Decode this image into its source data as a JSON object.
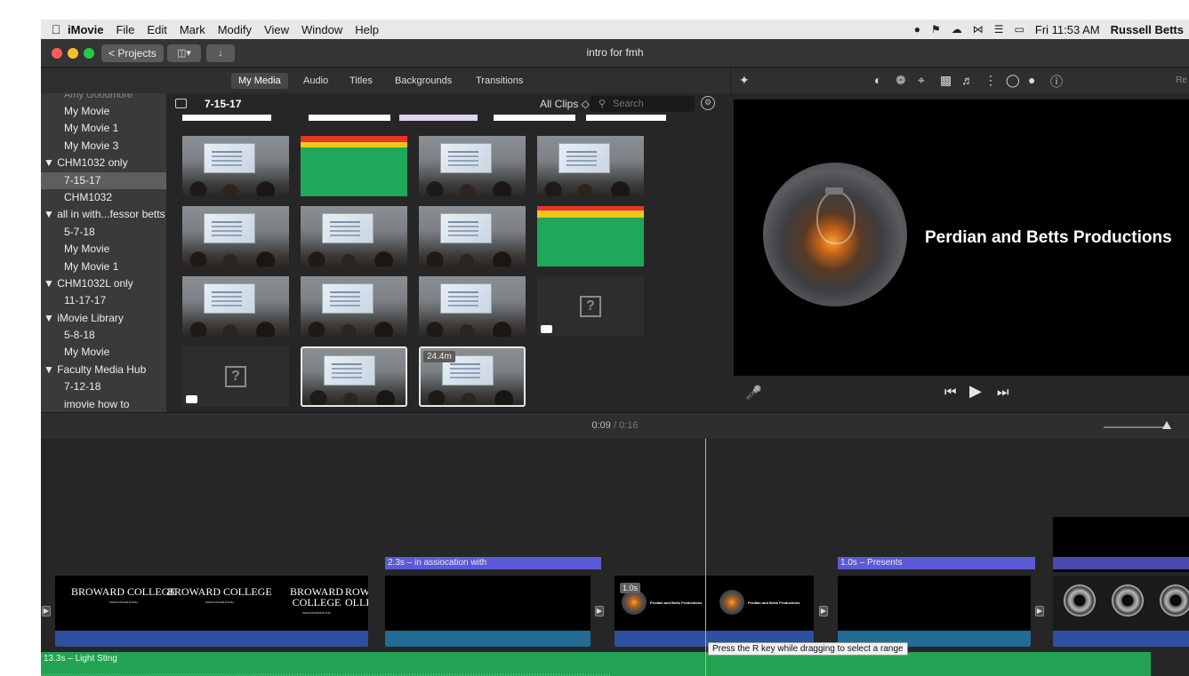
{
  "menubar": {
    "app": "iMovie",
    "items": [
      "File",
      "Edit",
      "Mark",
      "Modify",
      "View",
      "Window",
      "Help"
    ],
    "clock": "Fri 11:53 AM",
    "user": "Russell Betts"
  },
  "window": {
    "title": "intro for fmh",
    "projects_button": "< Projects"
  },
  "tabs": [
    "My Media",
    "Audio",
    "Titles",
    "Backgrounds",
    "Transitions"
  ],
  "sidebar": {
    "items": [
      {
        "label": "Amy Goodmore",
        "kind": "faded"
      },
      {
        "label": "My Movie",
        "kind": "child"
      },
      {
        "label": "My Movie 1",
        "kind": "child"
      },
      {
        "label": "My Movie 3",
        "kind": "child"
      },
      {
        "label": "▼ CHM1032 only",
        "kind": "parent"
      },
      {
        "label": "7-15-17",
        "kind": "child selected"
      },
      {
        "label": "CHM1032",
        "kind": "child"
      },
      {
        "label": "▼ all in with...fessor betts",
        "kind": "parent"
      },
      {
        "label": "5-7-18",
        "kind": "child"
      },
      {
        "label": "My Movie",
        "kind": "child"
      },
      {
        "label": "My Movie 1",
        "kind": "child"
      },
      {
        "label": "▼ CHM1032L only",
        "kind": "parent"
      },
      {
        "label": "11-17-17",
        "kind": "child"
      },
      {
        "label": "▼ iMovie Library",
        "kind": "parent"
      },
      {
        "label": "5-8-18",
        "kind": "child"
      },
      {
        "label": "My Movie",
        "kind": "child"
      },
      {
        "label": "▼ Faculty Media Hub",
        "kind": "parent"
      },
      {
        "label": "7-12-18",
        "kind": "child"
      },
      {
        "label": "imovie how to",
        "kind": "child"
      }
    ]
  },
  "browser": {
    "event_date": "7-15-17",
    "filter": "All Clips ◇",
    "search_placeholder": "Search",
    "clip_duration_badge": "24.4m"
  },
  "viewer": {
    "title_text": "Perdian and Betts Productions",
    "resolution_hint": "Re"
  },
  "timeline": {
    "current_time": "0:09",
    "total_time": " / 0:16",
    "title_clips": [
      "2.3s – in assiocation with",
      "1.0s – Presents"
    ],
    "clip_badge": "1.0s",
    "audio_label": "13.3s – Light Sting",
    "tooltip": "Press the R key while dragging to select a range",
    "logo_text": "BROWARD COLLEGE",
    "logo_sub": "www.broward.edu",
    "logo_partial": "ROWA OLLE"
  }
}
